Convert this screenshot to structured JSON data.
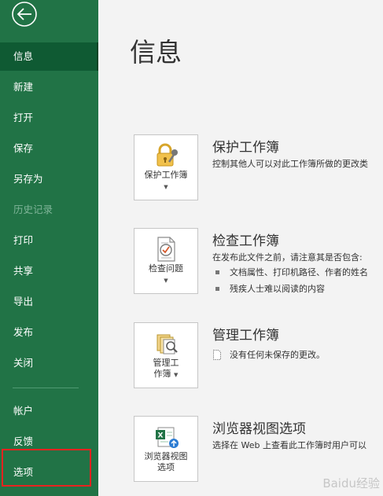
{
  "sidebar": {
    "items": [
      {
        "label": "信息"
      },
      {
        "label": "新建"
      },
      {
        "label": "打开"
      },
      {
        "label": "保存"
      },
      {
        "label": "另存为"
      },
      {
        "label": "历史记录"
      },
      {
        "label": "打印"
      },
      {
        "label": "共享"
      },
      {
        "label": "导出"
      },
      {
        "label": "发布"
      },
      {
        "label": "关闭"
      },
      {
        "label": "帐户"
      },
      {
        "label": "反馈"
      },
      {
        "label": "选项"
      }
    ],
    "selected": "信息",
    "disabled": "历史记录",
    "highlighted": "选项"
  },
  "main": {
    "title": "信息",
    "sections": [
      {
        "tile_label": "保护工作簿",
        "title": "保护工作簿",
        "desc": "控制其他人可以对此工作簿所做的更改类"
      },
      {
        "tile_label": "检查问题",
        "title": "检查工作簿",
        "desc": "在发布此文件之前，请注意其是否包含:",
        "bullets": [
          "文档属性、打印机路径、作者的姓名",
          "残疾人士难以阅读的内容"
        ]
      },
      {
        "tile_label_line1": "管理工",
        "tile_label_line2": "作簿",
        "title": "管理工作簿",
        "note": "没有任何未保存的更改。"
      },
      {
        "tile_label_line1": "浏览器视图",
        "tile_label_line2": "选项",
        "title": "浏览器视图选项",
        "desc": "选择在 Web 上查看此工作簿时用户可以"
      }
    ]
  },
  "colors": {
    "sidebar_bg": "#217346",
    "sidebar_selected": "#0f5a33",
    "highlight_box": "#e8231f",
    "main_bg": "#f3f3f3"
  },
  "watermark": "Baidu经验"
}
